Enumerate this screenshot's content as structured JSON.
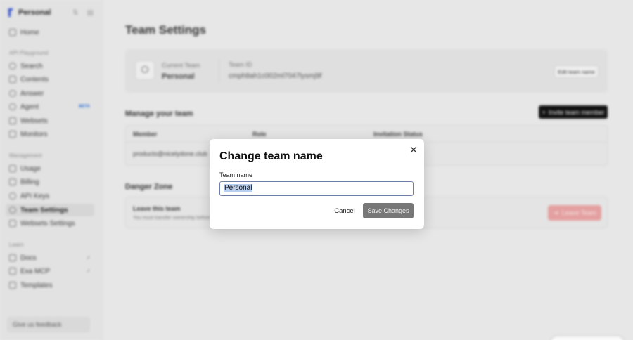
{
  "sidebar": {
    "brand_name": "Personal",
    "sections": {
      "api_playground": "API Playground",
      "management": "Management",
      "learn": "Learn"
    },
    "items": {
      "home": "Home",
      "search": "Search",
      "contents": "Contents",
      "answer": "Answer",
      "agent": "Agent",
      "agent_badge": "BETA",
      "websets": "Websets",
      "monitors": "Monitors",
      "usage": "Usage",
      "billing": "Billing",
      "api_keys": "API Keys",
      "team_settings": "Team Settings",
      "websets_settings": "Websets Settings",
      "docs": "Docs",
      "exa_mcp": "Exa MCP",
      "templates": "Templates"
    },
    "feedback": "Give us feedback"
  },
  "main": {
    "page_title": "Team Settings",
    "current_team_label": "Current Team",
    "current_team_value": "Personal",
    "team_id_label": "Team ID",
    "team_id_value": "cmph8ah1c002ml7047lysmj9f",
    "edit_team_name": "Edit team name",
    "manage_title": "Manage your team",
    "invite_button": "Invite team member",
    "table_headers": [
      "Member",
      "Role",
      "Invitation Status"
    ],
    "member_email": "products@nicelydone.club",
    "danger_zone": "Danger Zone",
    "leave_title": "Leave this team",
    "leave_desc": "You must transfer ownership before",
    "leave_button": "Leave Team"
  },
  "modal": {
    "title": "Change team name",
    "field_label": "Team name",
    "input_value": "Personal",
    "cancel": "Cancel",
    "save": "Save Changes"
  }
}
